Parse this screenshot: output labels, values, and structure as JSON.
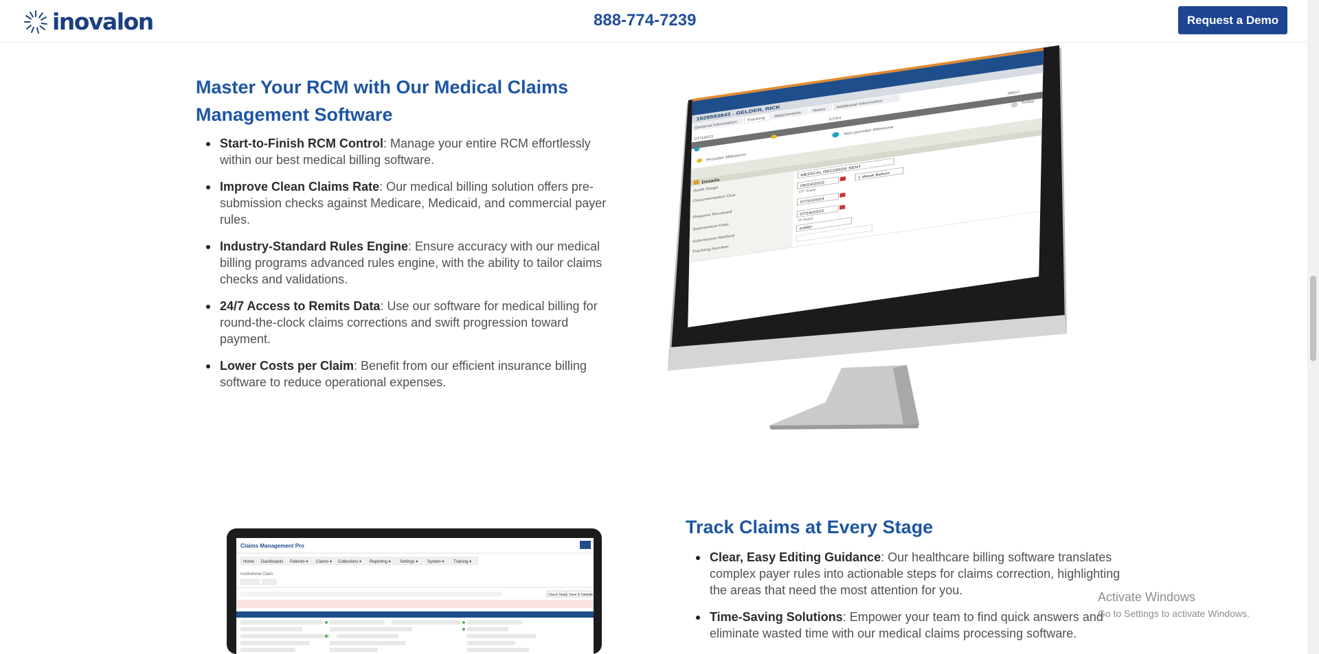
{
  "header": {
    "logo_alt": "inovalon",
    "phone": "888-774-7239",
    "demo_button": "Request a Demo"
  },
  "section1": {
    "title": "Master Your RCM with Our Medical Claims Management Software",
    "items": [
      {
        "bold": "Start-to-Finish RCM Control",
        "text": ": Manage your entire RCM effortlessly within our best medical billing software."
      },
      {
        "bold": "Improve Clean Claims Rate",
        "text": ": Our medical billing solution offers pre-submission checks against Medicare, Medicaid, and commercial payer rules."
      },
      {
        "bold": "Industry-Standard Rules Engine",
        "text": ": Ensure accuracy with our medical billing programs advanced rules engine, with the ability to tailor claims checks and validations."
      },
      {
        "bold": "24/7 Access to Remits Data",
        "text": ": Use our software for medical billing for round-the-clock claims corrections and swift progression toward payment."
      },
      {
        "bold": "Lower Costs per Claim",
        "text": ": Benefit from our efficient insurance billing software to reduce operational expenses."
      }
    ]
  },
  "monitor_screen": {
    "patient": "1928593843 - GELDER, RICK",
    "tabs": [
      "General Information",
      "Tracking",
      "Attachments",
      "Notes",
      "Additional Information"
    ],
    "dates": [
      "07/10/23",
      "07/24",
      "08/07",
      "Today"
    ],
    "legend": [
      "Provider Milestone",
      "Non-provider Milestone"
    ],
    "details_label": "Details",
    "fields": [
      {
        "label": "Audit Stage",
        "value": "MEDICAL RECORDS SENT"
      },
      {
        "label": "Documentation Due",
        "value": "08/24/2023",
        "note": "(37 days)",
        "extra": "1 Week Before"
      },
      {
        "label": "Request Received",
        "value": "07/10/2023"
      },
      {
        "label": "Submission Date",
        "value": "07/18/2023",
        "note": "(0 days)"
      },
      {
        "label": "Submission Method",
        "value": "esMD"
      },
      {
        "label": "Tracking Number",
        "value": ""
      }
    ]
  },
  "laptop_screen": {
    "app_title": "Claims Management Pro",
    "menu": [
      "Home",
      "Dashboards",
      "Patients ▾",
      "Claims ▾",
      "Collections ▾",
      "Reporting ▾",
      "Settings ▾",
      "System ▾",
      "Training ▾"
    ],
    "subtitle": "Institutional Claim",
    "buttons": [
      "Check Status",
      "Save & Validate"
    ]
  },
  "section2": {
    "title": "Track Claims at Every Stage",
    "items": [
      {
        "bold": "Clear, Easy Editing Guidance",
        "text": ": Our healthcare billing software translates complex payer rules into actionable steps for claims correction, highlighting the areas that need the most attention for you."
      },
      {
        "bold": "Time-Saving Solutions",
        "text": ": Empower your team to find quick answers and eliminate wasted time with our medical claims processing software."
      }
    ]
  },
  "watermark": {
    "title": "Activate Windows",
    "subtitle": "Go to Settings to activate Windows."
  },
  "colors": {
    "brand_blue": "#1c4592",
    "heading_blue": "#1e55a3"
  }
}
